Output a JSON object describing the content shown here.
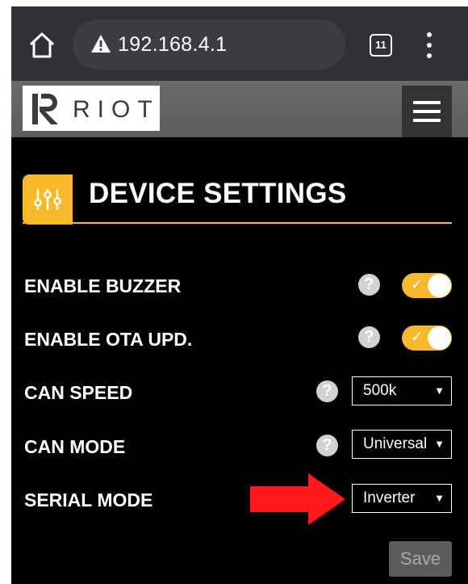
{
  "browser": {
    "url": "192.168.4.1",
    "tab_count": "11"
  },
  "header": {
    "logo_text": "RIOT"
  },
  "page": {
    "title": "DEVICE SETTINGS"
  },
  "settings": [
    {
      "label": "ENABLE BUZZER",
      "control": "toggle",
      "value": true
    },
    {
      "label": "ENABLE OTA UPD.",
      "control": "toggle",
      "value": true
    },
    {
      "label": "CAN SPEED",
      "control": "select",
      "value": "500k"
    },
    {
      "label": "CAN MODE",
      "control": "select",
      "value": "Universal"
    },
    {
      "label": "SERIAL MODE",
      "control": "select",
      "value": "Inverter"
    }
  ],
  "help_symbol": "?",
  "toggle_check": "✓",
  "select_caret": "▼",
  "save_label": "Save",
  "colors": {
    "accent": "#f7b92c",
    "background": "#000000",
    "annotation_arrow": "#ff1a1a"
  }
}
